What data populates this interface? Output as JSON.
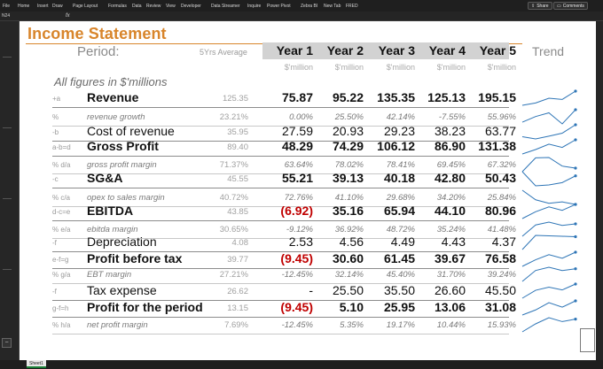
{
  "ribbon": {
    "tabs": [
      "File",
      "Home",
      "Insert",
      "Draw",
      "Page Layout",
      "Formulas",
      "Data",
      "Review",
      "View",
      "Developer",
      "Data Streamer",
      "Inquire",
      "Power Pivot",
      "Zebra BI",
      "New Tab",
      "FRED"
    ],
    "share": "Share",
    "comments": "Comments"
  },
  "formula": {
    "namebox": "N24",
    "fx": "fx",
    "value": ""
  },
  "sheet": {
    "title": "Income Statement",
    "period_label": "Period:",
    "avg_label": "5Yrs Average",
    "years": [
      "Year 1",
      "Year 2",
      "Year 3",
      "Year 4",
      "Year 5"
    ],
    "trend_label": "Trend",
    "unit": "$'million",
    "figures_note": "All figures in $'millions",
    "tab_name": "Sheet1"
  },
  "rows": [
    {
      "code": "+a",
      "label": "Revenue",
      "avg": "125.35",
      "values": [
        "75.87",
        "95.22",
        "135.35",
        "125.13",
        "195.15"
      ],
      "style": "major",
      "bold": true
    },
    {
      "code": "%",
      "label": "revenue growth",
      "avg": "23.21%",
      "values": [
        "0.00%",
        "25.50%",
        "42.14%",
        "-7.55%",
        "55.96%"
      ],
      "style": "minor"
    },
    {
      "code": "-b",
      "label": "Cost of revenue",
      "avg": "35.95",
      "values": [
        "27.59",
        "20.93",
        "29.23",
        "38.23",
        "63.77"
      ],
      "style": "major",
      "bold": false
    },
    {
      "code": "a-b=d",
      "label": "Gross Profit",
      "avg": "89.40",
      "values": [
        "48.29",
        "74.29",
        "106.12",
        "86.90",
        "131.38"
      ],
      "style": "major",
      "bold": true
    },
    {
      "code": "% d/a",
      "label": "gross profit margin",
      "avg": "71.37%",
      "values": [
        "63.64%",
        "78.02%",
        "78.41%",
        "69.45%",
        "67.32%"
      ],
      "style": "minor"
    },
    {
      "code": "-c",
      "label": "SG&A",
      "avg": "45.55",
      "values": [
        "55.21",
        "39.13",
        "40.18",
        "42.80",
        "50.43"
      ],
      "style": "major",
      "bold": true
    },
    {
      "code": "% c/a",
      "label": "opex to sales margin",
      "avg": "40.72%",
      "values": [
        "72.76%",
        "41.10%",
        "29.68%",
        "34.20%",
        "25.84%"
      ],
      "style": "minor"
    },
    {
      "code": "d-c=e",
      "label": "EBITDA",
      "avg": "43.85",
      "values": [
        "(6.92)",
        "35.16",
        "65.94",
        "44.10",
        "80.96"
      ],
      "style": "major",
      "bold": true
    },
    {
      "code": "% e/a",
      "label": "ebitda margin",
      "avg": "30.65%",
      "values": [
        "-9.12%",
        "36.92%",
        "48.72%",
        "35.24%",
        "41.48%"
      ],
      "style": "minor"
    },
    {
      "code": "-f",
      "label": "Depreciation",
      "avg": "4.08",
      "values": [
        "2.53",
        "4.56",
        "4.49",
        "4.43",
        "4.37"
      ],
      "style": "major",
      "bold": false
    },
    {
      "code": "e-f=g",
      "label": "Profit before tax",
      "avg": "39.77",
      "values": [
        "(9.45)",
        "30.60",
        "61.45",
        "39.67",
        "76.58"
      ],
      "style": "major",
      "bold": true
    },
    {
      "code": "% g/a",
      "label": "EBT margin",
      "avg": "27.21%",
      "values": [
        "-12.45%",
        "32.14%",
        "45.40%",
        "31.70%",
        "39.24%"
      ],
      "style": "minor"
    },
    {
      "code": "-f",
      "label": "Tax expense",
      "avg": "26.62",
      "values": [
        "-",
        "25.50",
        "35.50",
        "26.60",
        "45.50"
      ],
      "style": "major",
      "bold": false
    },
    {
      "code": "g-f=h",
      "label": "Profit for the period",
      "avg": "13.15",
      "values": [
        "(9.45)",
        "5.10",
        "25.95",
        "13.06",
        "31.08"
      ],
      "style": "major",
      "bold": true
    },
    {
      "code": "% h/a",
      "label": "net profit margin",
      "avg": "7.69%",
      "values": [
        "-12.45%",
        "5.35%",
        "19.17%",
        "10.44%",
        "15.93%"
      ],
      "style": "minor"
    }
  ],
  "colors": {
    "title": "#d8852b",
    "negative": "#c00000",
    "spark": "#2e75b6"
  }
}
